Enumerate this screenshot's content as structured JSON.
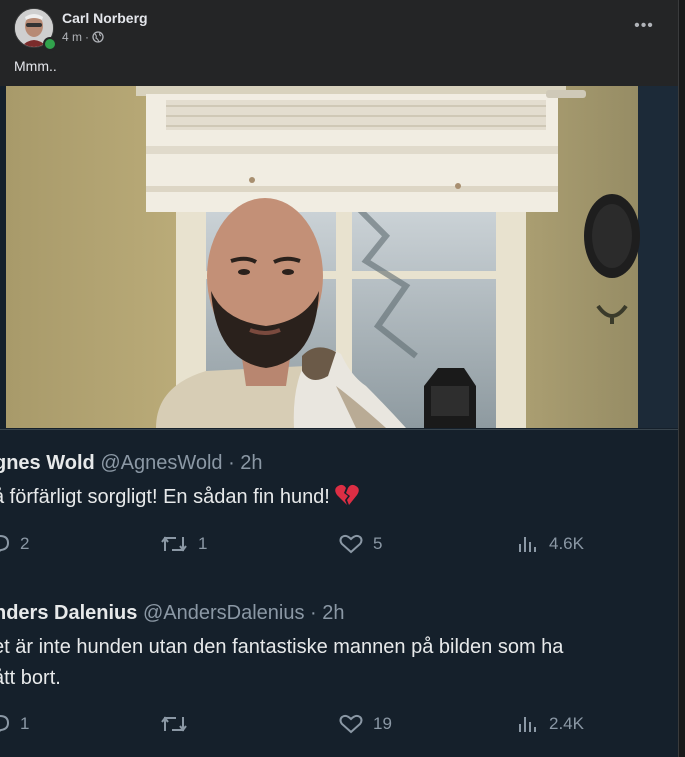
{
  "post": {
    "author": "Carl Norberg",
    "time": "4 m",
    "separator": "·",
    "more_label": "•••",
    "text": "Mmm.."
  },
  "tweets": [
    {
      "name": "gnes Wold",
      "handle": "@AgnesWold",
      "time": "· 2h",
      "lines": [
        "å förfärligt sorgligt! En sådan fin hund!"
      ],
      "emoji": "broken-heart-icon",
      "replies": "2",
      "retweets": "1",
      "likes": "5",
      "views": "4.6K"
    },
    {
      "name": "nders Dalenius",
      "handle": "@AndersDalenius",
      "time": "· 2h",
      "lines": [
        "et är inte hunden utan den fantastiske mannen på bilden som ha",
        "ått bort."
      ],
      "replies": "1",
      "retweets": "",
      "likes": "19",
      "views": "2.4K"
    }
  ],
  "colors": {
    "facebook_bg": "#242526",
    "twitter_bg": "#15202b",
    "online": "#31a24c",
    "muted": "#8b98a5"
  }
}
